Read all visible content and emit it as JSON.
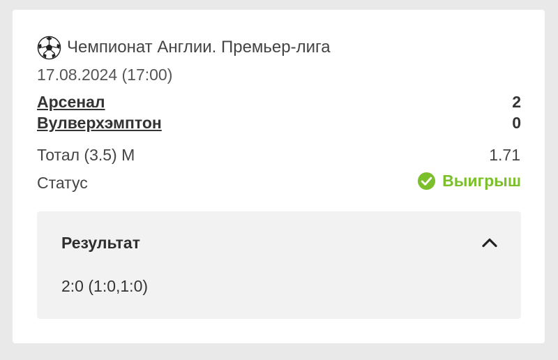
{
  "bet": {
    "league": "Чемпионат Англии. Премьер-лига",
    "league_icon": "soccer-ball-icon",
    "date": "17.08.2024 (17:00)",
    "home_team": "Арсенал",
    "away_team": "Вулверхэмптон",
    "home_score": "2",
    "away_score": "0",
    "market": "Тотал (3.5) М",
    "odds": "1.71",
    "status_label": "Статус",
    "status_value": "Выигрыш",
    "status_icon": "check-circle-icon",
    "status_color": "#7bbf2a"
  },
  "result": {
    "title": "Результат",
    "value": "2:0 (1:0,1:0)",
    "toggle_icon": "chevron-up-icon",
    "expanded": true
  },
  "colors": {
    "page_background": "#e9e9e9",
    "card_background": "#ffffff",
    "result_background": "#f2f2f2",
    "text": "#333333"
  }
}
